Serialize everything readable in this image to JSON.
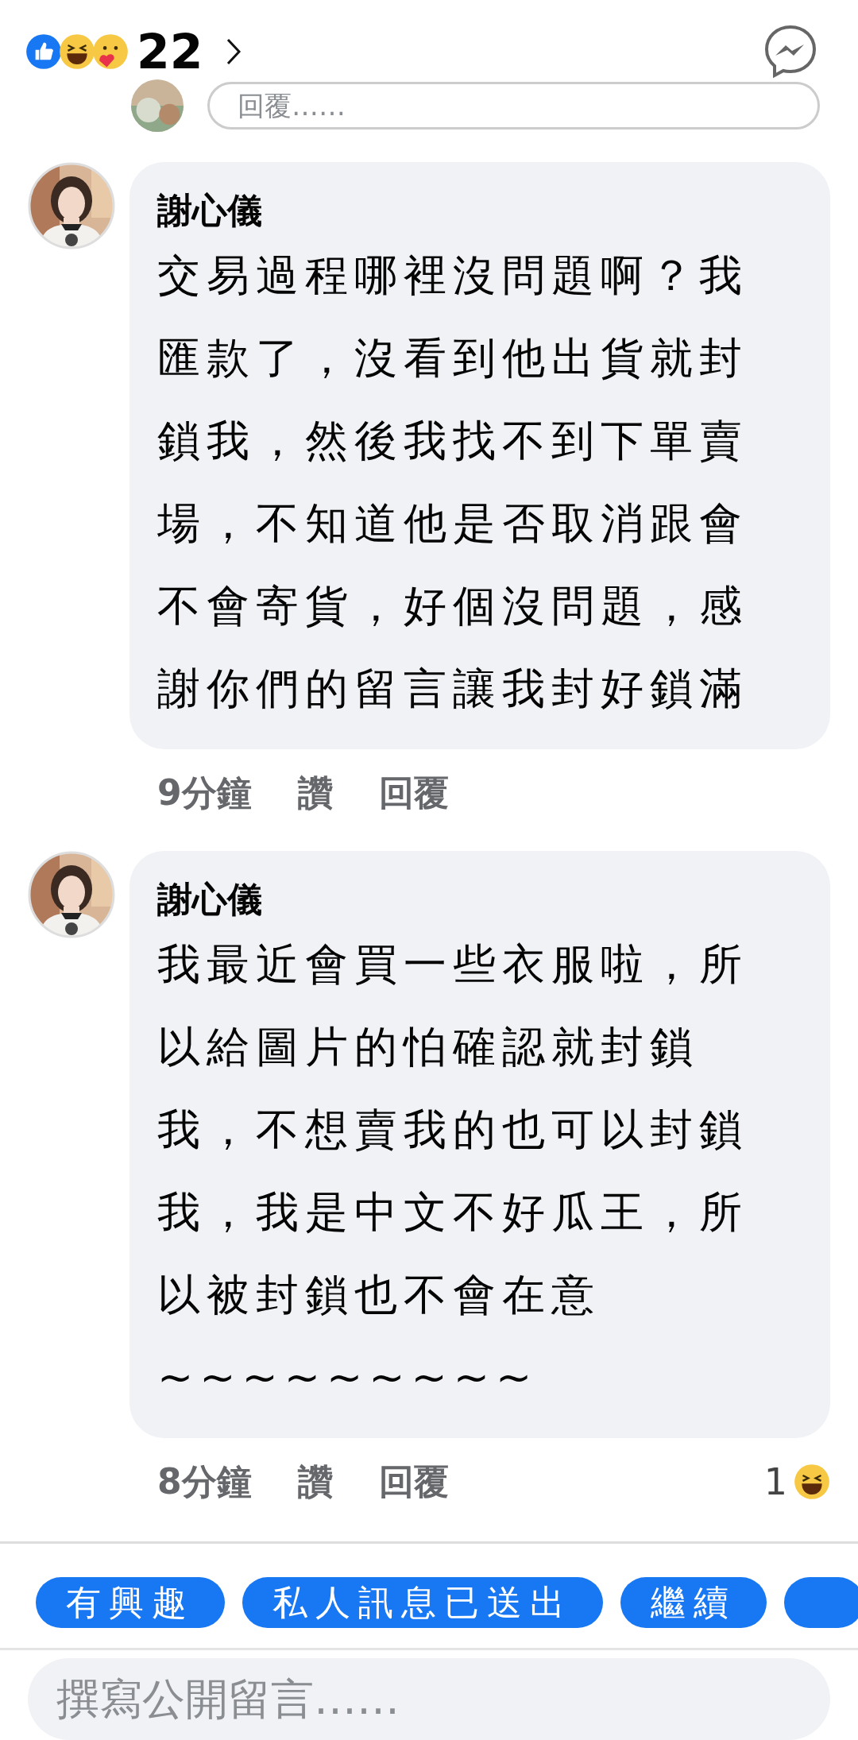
{
  "header": {
    "reaction_count": "22"
  },
  "reply_field": {
    "placeholder": "回覆……"
  },
  "comments": [
    {
      "author": "謝心儀",
      "lines": [
        "交易過程哪裡沒問題啊？我",
        "匯款了，沒看到他出貨就封",
        "鎖我，然後我找不到下單賣",
        "場，不知道他是否取消跟會",
        "不會寄貨，好個沒問題，感",
        "謝你們的留言讓我封好鎖滿"
      ],
      "time": "9分鐘",
      "like": "讚",
      "reply": "回覆"
    },
    {
      "author": "謝心儀",
      "lines": [
        "我最近會買一些衣服啦，所",
        "以給圖片的怕確認就封鎖",
        "我，不想賣我的也可以封鎖",
        "我，我是中文不好瓜王，所",
        "以被封鎖也不會在意",
        "~~~~~~~~~"
      ],
      "time": "8分鐘",
      "like": "讚",
      "reply": "回覆",
      "reactions": "1"
    }
  ],
  "quick_replies": [
    "有興趣",
    "私人訊息已送出",
    "繼續"
  ],
  "composer": {
    "placeholder": "撰寫公開留言……"
  }
}
